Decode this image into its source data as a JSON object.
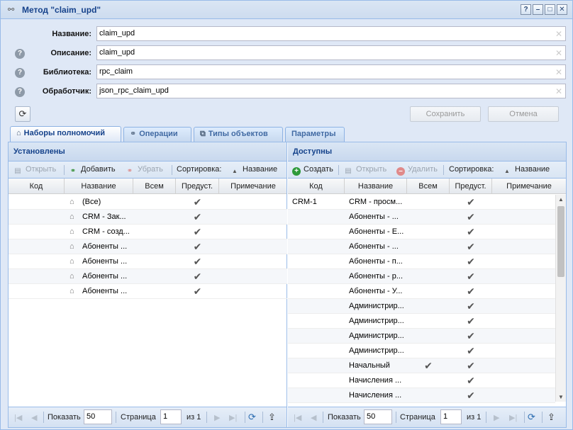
{
  "window": {
    "title": "Метод \"claim_upd\"",
    "tools": [
      "?",
      "–",
      "□",
      "✕"
    ]
  },
  "form": {
    "name_label": "Название:",
    "name_value": "claim_upd",
    "desc_label": "Описание:",
    "desc_value": "claim_upd",
    "lib_label": "Библиотека:",
    "lib_value": "rpc_claim",
    "handler_label": "Обработчик:",
    "handler_value": "json_rpc_claim_upd",
    "help": "?",
    "save_label": "Сохранить",
    "cancel_label": "Отмена"
  },
  "tabs": [
    {
      "label": "Наборы полномочий",
      "icon": "basket-icon"
    },
    {
      "label": "Операции",
      "icon": "link-icon"
    },
    {
      "label": "Типы объектов",
      "icon": "object-types-icon"
    },
    {
      "label": "Параметры",
      "icon": ""
    }
  ],
  "left": {
    "title": "Установлены",
    "toolbar": {
      "open": "Открыть",
      "add": "Добавить",
      "remove": "Убрать",
      "sort_label": "Сортировка:",
      "sort_field": "Название"
    },
    "columns": [
      "Код",
      "Название",
      "Всем",
      "Предуст.",
      "Примечание"
    ],
    "rows": [
      {
        "code": "",
        "name": "(Все)",
        "all": "",
        "preset": "✔",
        "note": ""
      },
      {
        "code": "",
        "name": "CRM - Зак...",
        "all": "",
        "preset": "✔",
        "note": ""
      },
      {
        "code": "",
        "name": "CRM - созд...",
        "all": "",
        "preset": "✔",
        "note": ""
      },
      {
        "code": "",
        "name": "Абоненты ...",
        "all": "",
        "preset": "✔",
        "note": ""
      },
      {
        "code": "",
        "name": "Абоненты ...",
        "all": "",
        "preset": "✔",
        "note": ""
      },
      {
        "code": "",
        "name": "Абоненты ...",
        "all": "",
        "preset": "✔",
        "note": ""
      },
      {
        "code": "",
        "name": "Абоненты ...",
        "all": "",
        "preset": "✔",
        "note": ""
      }
    ],
    "pager": {
      "show_label": "Показать",
      "page_size": "50",
      "page_label": "Страница",
      "page": "1",
      "of_label": "из 1"
    }
  },
  "right": {
    "title": "Доступны",
    "toolbar": {
      "create": "Создать",
      "open": "Открыть",
      "delete": "Удалить",
      "sort_label": "Сортировка:",
      "sort_field": "Название"
    },
    "columns": [
      "Код",
      "Название",
      "Всем",
      "Предуст.",
      "Примечание"
    ],
    "rows": [
      {
        "code": "CRM-1",
        "name": "CRM - просм...",
        "all": "",
        "preset": "✔",
        "note": ""
      },
      {
        "code": "",
        "name": "Абоненты - ...",
        "all": "",
        "preset": "✔",
        "note": ""
      },
      {
        "code": "",
        "name": "Абоненты - Е...",
        "all": "",
        "preset": "✔",
        "note": ""
      },
      {
        "code": "",
        "name": "Абоненты - ...",
        "all": "",
        "preset": "✔",
        "note": ""
      },
      {
        "code": "",
        "name": "Абоненты - п...",
        "all": "",
        "preset": "✔",
        "note": ""
      },
      {
        "code": "",
        "name": "Абоненты - р...",
        "all": "",
        "preset": "✔",
        "note": ""
      },
      {
        "code": "",
        "name": "Абоненты - У...",
        "all": "",
        "preset": "✔",
        "note": ""
      },
      {
        "code": "",
        "name": "Администрир...",
        "all": "",
        "preset": "✔",
        "note": ""
      },
      {
        "code": "",
        "name": "Администрир...",
        "all": "",
        "preset": "✔",
        "note": ""
      },
      {
        "code": "",
        "name": "Администрир...",
        "all": "",
        "preset": "✔",
        "note": ""
      },
      {
        "code": "",
        "name": "Администрир...",
        "all": "",
        "preset": "✔",
        "note": ""
      },
      {
        "code": "",
        "name": "Начальный",
        "all": "✔",
        "preset": "✔",
        "note": ""
      },
      {
        "code": "",
        "name": "Начисления ...",
        "all": "",
        "preset": "✔",
        "note": ""
      },
      {
        "code": "",
        "name": "Начисления ...",
        "all": "",
        "preset": "✔",
        "note": ""
      }
    ],
    "pager": {
      "show_label": "Показать",
      "page_size": "50",
      "page_label": "Страница",
      "page": "1",
      "of_label": "из 1"
    }
  }
}
